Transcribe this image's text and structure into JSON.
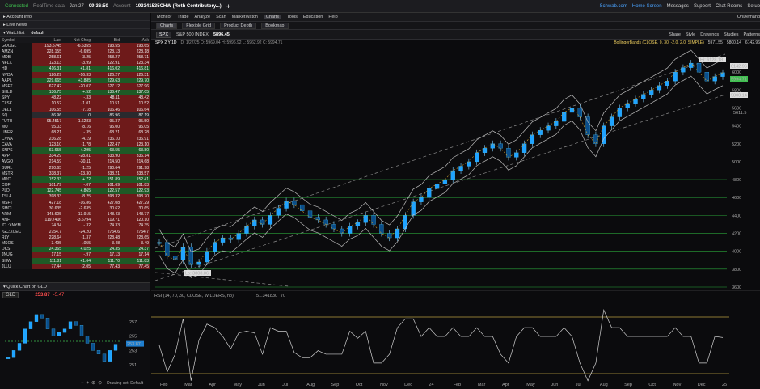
{
  "topbar": {
    "status": "Connected",
    "mode": "RealTime data",
    "date": "Jan 27",
    "time": "09:36:50",
    "account_label": "Account",
    "account": "193341535CHW (Roth Contributory...)",
    "links": [
      "Schwab.com",
      "Home Screen",
      "Messages",
      "Support",
      "Chat Rooms",
      "Setup"
    ]
  },
  "left": {
    "account_info": "Account Info",
    "live_news": "Live News",
    "watchlist_label": "Watchlist",
    "watchlist_name": "default",
    "columns": [
      "Symbol",
      "Last",
      "Net Chng",
      "Bid",
      "Ask"
    ],
    "rows": [
      [
        "GOOGL",
        "193.5745",
        "-6.6355",
        "193.55",
        "193.65",
        "dn"
      ],
      [
        "AMZN",
        "228.155",
        "-6.695",
        "228.13",
        "228.18",
        "dn"
      ],
      [
        "MDB",
        "258.61",
        "-3.25",
        "258.27",
        "258.71",
        "dn"
      ],
      [
        "NFLX",
        "123.13",
        "-3.99",
        "122.91",
        "123.34",
        "dn"
      ],
      [
        "HD",
        "416.31",
        "+1.81",
        "416.02",
        "416.81",
        "up"
      ],
      [
        "NVDA",
        "126.29",
        "-16.33",
        "126.27",
        "126.31",
        "dn"
      ],
      [
        "AAPL",
        "229.665",
        "+3.885",
        "229.63",
        "229.70",
        "up"
      ],
      [
        "MSFT",
        "627.42",
        "-20.07",
        "627.12",
        "627.96",
        "dn"
      ],
      [
        "SHLD",
        "136.75",
        "+.52",
        "136.47",
        "137.05",
        "up"
      ],
      [
        "SPY",
        "48.22",
        "-.33",
        "48.11",
        "48.42",
        "dn"
      ],
      [
        "CLSK",
        "10.52",
        "-1.01",
        "10.51",
        "10.52",
        "dn"
      ],
      [
        "DELL",
        "106.55",
        "-7.18",
        "106.46",
        "106.64",
        "dn"
      ],
      [
        "SQ",
        "86.96",
        "0",
        "86.96",
        "87.19",
        "nt"
      ],
      [
        "FUTU",
        "95.4517",
        "-1.6283",
        "95.37",
        "95.50",
        "dn"
      ],
      [
        "MU",
        "95.03",
        "-8.16",
        "95.00",
        "95.05",
        "dn"
      ],
      [
        "UBER",
        "68.21",
        "-.35",
        "68.21",
        "68.28",
        "dn"
      ],
      [
        "CVNA",
        "236.28",
        "-4.19",
        "236.10",
        "236.91",
        "dn"
      ],
      [
        "CAVA",
        "123.10",
        "-1.78",
        "122.47",
        "123.10",
        "dn"
      ],
      [
        "SNPS",
        "63.655",
        "+.295",
        "63.55",
        "63.80",
        "up"
      ],
      [
        "APP",
        "334.29",
        "-28.81",
        "333.90",
        "336.14",
        "dn"
      ],
      [
        "AVGO",
        "214.59",
        "-30.11",
        "214.50",
        "214.68",
        "dn"
      ],
      [
        "BURL",
        "290.65",
        "-1.25",
        "290.64",
        "291.98",
        "dn"
      ],
      [
        "MSTR",
        "338.37",
        "-13.30",
        "338.21",
        "338.57",
        "dn"
      ],
      [
        "MPC",
        "152.33",
        "+.72",
        "151.89",
        "152.41",
        "up"
      ],
      [
        "COF",
        "101.79",
        "-.07",
        "101.69",
        "101.83",
        "dn"
      ],
      [
        "PLD",
        "122.745",
        "+.865",
        "122.57",
        "122.93",
        "up"
      ],
      [
        "TSLA",
        "398.33",
        "-8.25",
        "398.32",
        "398.70",
        "dn"
      ],
      [
        "MSFT",
        "427.18",
        "-16.86",
        "427.08",
        "427.29",
        "dn"
      ],
      [
        "SMCI",
        "30.635",
        "-2.635",
        "30.62",
        "30.65",
        "dn"
      ],
      [
        "ARM",
        "148.605",
        "-13.915",
        "148.43",
        "148.77",
        "dn"
      ],
      [
        "ANF",
        "119.7406",
        "-3.6794",
        "119.71",
        "120.10",
        "dn"
      ],
      [
        "/CL:XNYM",
        "74.34",
        "-.32",
        "74.33",
        "74.35",
        "dn"
      ],
      [
        "/GC:XCEC",
        "2754.7",
        "-24.20",
        "2754.6",
        "2754.7",
        "dn"
      ],
      [
        "RLY",
        "228.64",
        "-1.37",
        "228.48",
        "228.65",
        "dn"
      ],
      [
        "MSOS",
        "3.495",
        "-.055",
        "3.48",
        "3.49",
        "dn"
      ],
      [
        "DKS",
        "24.365",
        "+.025",
        "24.35",
        "24.37",
        "up"
      ],
      [
        "JNUG",
        "17.15",
        "-.97",
        "17.13",
        "17.14",
        "dn"
      ],
      [
        "SHW",
        "111.81",
        "+1.64",
        "111.70",
        "111.83",
        "up"
      ],
      [
        "JLLU",
        "77.44",
        "-2.05",
        "77.43",
        "77.45",
        "dn"
      ]
    ],
    "quick_title": "Quick Chart on GLD",
    "quick_symbol": "GLD",
    "quick_price": "253.87",
    "quick_change": "-5.47",
    "quick_axis": [
      "257",
      "255",
      "253",
      "251"
    ],
    "quick_drawing": "Drawing set: Default"
  },
  "menu": {
    "items": [
      "Monitor",
      "Trade",
      "Analyze",
      "Scan",
      "MarketWatch",
      "Charts",
      "Tools",
      "Education",
      "Help"
    ],
    "active": "Charts",
    "subtabs": [
      "Charts",
      "Flexible Grid",
      "Product Depth",
      "Bookmap"
    ],
    "ondemand": "OnDemand"
  },
  "chart": {
    "symbol": "SPX",
    "name": "S&P 500 INDEX",
    "price": "5896.45",
    "period": "SPX 2 Y 1D",
    "ohlc": "D: 1/27/25  O: 5969.04  H: 5996.92  L: 5962.92  C: 5994.71",
    "bb_label": "BollingerBands (CLOSE, 0, 30, -2.0, 2.0, SIMPLE)",
    "bb_values": [
      "5971.55",
      "5800.14",
      "6142.96"
    ],
    "toolbar": [
      "Share",
      "Style",
      "Drawings",
      "Studies",
      "Patterns"
    ],
    "hi_label": "Hi: 6128.18",
    "lo_label": "Lo: 3808.86",
    "price_tags": [
      "6142.96",
      "5994.71",
      "5800.14",
      "5611.5"
    ],
    "rsi_label": "RSI (14, 70, 30, CLOSE, WILDERS, no)",
    "rsi_value": "51.3418",
    "rsi_levels": [
      "30",
      "70"
    ],
    "chart_data": {
      "type": "line",
      "ylim": [
        3600,
        6200
      ],
      "y_ticks": [
        6000,
        5800,
        5600,
        5400,
        5200,
        5000,
        4800,
        4600,
        4400,
        4200,
        4000,
        3800,
        3600
      ],
      "x_ticks": [
        "Feb",
        "Mar",
        "Apr",
        "May",
        "Jun",
        "Jul",
        "Aug",
        "Sep",
        "Oct",
        "Nov",
        "Dec",
        "24",
        "Feb",
        "Mar",
        "Apr",
        "May",
        "Jun",
        "Jul",
        "Aug",
        "Sep",
        "Oct",
        "Nov",
        "Dec",
        "25"
      ],
      "series": [
        {
          "values": [
            4100,
            3950,
            3900,
            4050,
            3850,
            3880,
            4000,
            4100,
            4150,
            4130,
            4200,
            4280,
            4350,
            4300,
            4400,
            4480,
            4560,
            4520,
            4450,
            4380,
            4350,
            4300,
            4250,
            4200,
            4280,
            4320,
            4400,
            4300,
            4200,
            4150,
            4250,
            4400,
            4550,
            4600,
            4700,
            4750,
            4800,
            4900,
            4950,
            5000,
            5100,
            5150,
            5200,
            5150,
            5050,
            5100,
            5200,
            5300,
            5350,
            5400,
            5450,
            5550,
            5600,
            5500,
            5300,
            5200,
            5400,
            5500,
            5600,
            5650,
            5700,
            5750,
            5800,
            5850,
            5900,
            6000,
            6050,
            6100,
            6000,
            5900,
            5950,
            5994
          ]
        }
      ]
    }
  }
}
